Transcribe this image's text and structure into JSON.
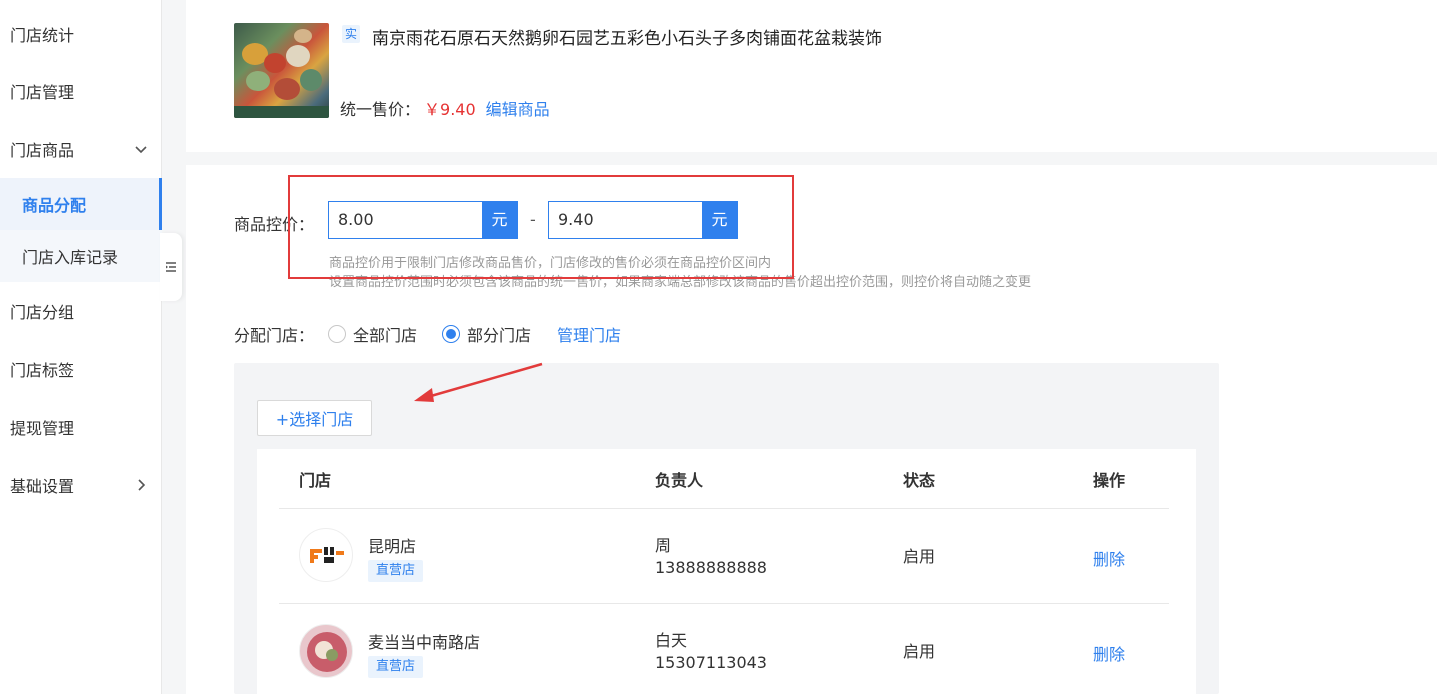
{
  "sidebar": {
    "items": [
      {
        "label": "门店统计"
      },
      {
        "label": "门店管理"
      },
      {
        "label": "门店商品"
      },
      {
        "label": "商品分配"
      },
      {
        "label": "门店入库记录"
      },
      {
        "label": "门店分组"
      },
      {
        "label": "门店标签"
      },
      {
        "label": "提现管理"
      },
      {
        "label": "基础设置"
      }
    ],
    "active": "商品分配"
  },
  "product": {
    "tag": "实",
    "title": "南京雨花石原石天然鹅卵石园艺五彩色小石头子多肉铺面花盆栽装饰",
    "price_label": "统一售价：",
    "price": "￥9.40",
    "edit_label": "编辑商品"
  },
  "price_control": {
    "label": "商品控价：",
    "min_value": "8.00",
    "max_value": "9.40",
    "unit": "元",
    "separator": "-",
    "hint_line1": "商品控价用于限制门店修改商品售价，门店修改的售价必须在商品控价区间内",
    "hint_line2": "设置商品控价范围时必须包含该商品的统一售价，如果商家端总部修改该商品的售价超出控价范围，则控价将自动随之变更"
  },
  "assign": {
    "label": "分配门店：",
    "options": [
      {
        "label": "全部门店",
        "checked": false
      },
      {
        "label": "部分门店",
        "checked": true
      }
    ],
    "manage_label": "管理门店",
    "select_button": "+选择门店"
  },
  "table": {
    "headers": [
      "门店",
      "负责人",
      "状态",
      "操作"
    ],
    "rows": [
      {
        "name": "昆明店",
        "tag": "直营店",
        "owner": "周",
        "phone": "13888888888",
        "status": "启用",
        "action": "删除"
      },
      {
        "name": "麦当当中南路店",
        "tag": "直营店",
        "owner": "白天",
        "phone": "15307113043",
        "status": "启用",
        "action": "删除"
      }
    ]
  },
  "colors": {
    "accent": "#2f80ed",
    "price_red": "#e63333",
    "highlight_box": "#e23b3b"
  }
}
